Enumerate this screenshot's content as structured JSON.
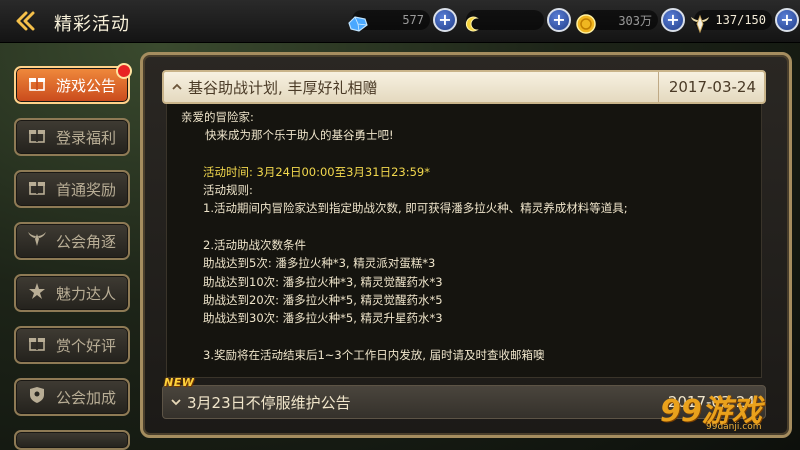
{
  "header": {
    "title": "精彩活动",
    "resources": [
      {
        "icon": "blue-crystal-icon",
        "value": "577"
      },
      {
        "icon": "yellow-crescent-icon",
        "value": ""
      },
      {
        "icon": "gold-coin-icon",
        "value": "303万"
      },
      {
        "icon": "winged-stamina-icon",
        "value": "137/150"
      }
    ]
  },
  "sidebar": {
    "items": [
      {
        "label": "游戏公告",
        "icon": "gift-icon",
        "active": true,
        "badge": true
      },
      {
        "label": "登录福利",
        "icon": "gift-icon"
      },
      {
        "label": "首通奖励",
        "icon": "gift-icon"
      },
      {
        "label": "公会角逐",
        "icon": "wings-emblem-icon"
      },
      {
        "label": "魅力达人",
        "icon": "star-character-icon"
      },
      {
        "label": "赏个好评",
        "icon": "gift-icon"
      },
      {
        "label": "公会加成",
        "icon": "shield-icon"
      }
    ]
  },
  "announcements": [
    {
      "title": "基谷助战计划, 丰厚好礼相赠",
      "date": "2017-03-24",
      "expanded": true,
      "lines": {
        "greeting": "亲爱的冒险家:",
        "intro": "快来成为那个乐于助人的基谷勇士吧!",
        "time": "活动时间: 3月24日00:00至3月31日23:59*",
        "rules_title": "活动规则:",
        "rule1": "1.活动期间内冒险家达到指定助战次数, 即可获得潘多拉火种、精灵养成材料等道具;",
        "rule2_title": "2.活动助战次数条件",
        "tier1": "助战达到5次: 潘多拉火种*3, 精灵派对蛋糕*3",
        "tier2": "助战达到10次: 潘多拉火种*3, 精灵觉醒药水*3",
        "tier3": "助战达到20次: 潘多拉火种*5, 精灵觉醒药水*5",
        "tier4": "助战达到30次: 潘多拉火种*5, 精灵升星药水*3",
        "rule3": "3.奖励将在活动结束后1~3个工作日内发放, 届时请及时查收邮箱噢"
      }
    },
    {
      "title": "3月23日不停服维护公告",
      "date": "2017-03-24",
      "badge": "NEW",
      "expanded": false
    }
  ],
  "watermark": {
    "big": "99游戏",
    "small": "99danji.com"
  },
  "colors": {
    "accent_orange": "#e0642a",
    "highlight_yellow": "#f2d84e",
    "panel_border": "#a58d5f"
  }
}
